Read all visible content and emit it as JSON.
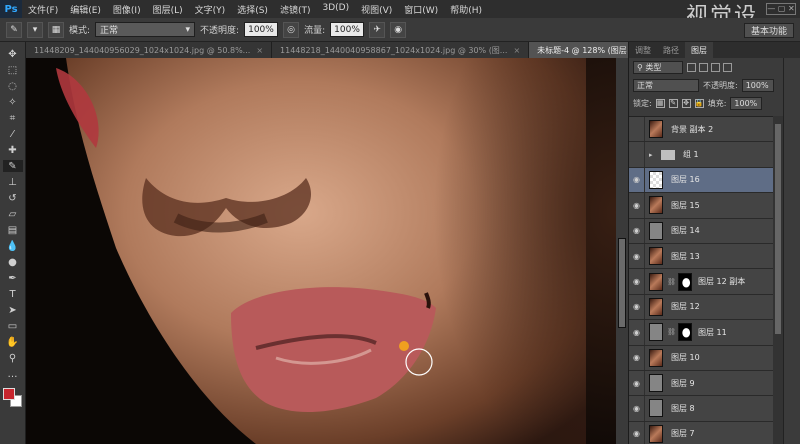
{
  "app": {
    "logo": "Ps"
  },
  "watermark": "视觉设",
  "menu": [
    "文件(F)",
    "编辑(E)",
    "图像(I)",
    "图层(L)",
    "文字(Y)",
    "选择(S)",
    "滤镜(T)",
    "3D(D)",
    "视图(V)",
    "窗口(W)",
    "帮助(H)"
  ],
  "options": {
    "mode_label": "模式:",
    "mode_value": "正常",
    "opacity_label": "不透明度:",
    "opacity_value": "100%",
    "flow_label": "流量:",
    "flow_value": "100%",
    "workspace": "基本功能"
  },
  "tabs": [
    {
      "label": "11448209_144040956029_1024x1024.jpg @ 50.8%...",
      "active": false
    },
    {
      "label": "11448218_1440040958867_1024x1024.jpg @ 30% (图...",
      "active": false
    },
    {
      "label": "未标题-4 @ 128% (图层 16, RGB/8) *",
      "active": true
    }
  ],
  "panel": {
    "tabs": [
      "调整",
      "路径",
      "图层"
    ],
    "active_tab": "图层",
    "kind": "类型",
    "blend_mode": "正常",
    "opacity_label": "不透明度:",
    "opacity_value": "100%",
    "lock_label": "锁定:",
    "fill_label": "填充:",
    "fill_value": "100%",
    "layers": [
      {
        "name": "背景 副本 2",
        "thumb": "face",
        "visible": false,
        "selected": false
      },
      {
        "name": "组 1",
        "thumb": "folder",
        "visible": false,
        "selected": false,
        "group": true
      },
      {
        "name": "图层 16",
        "thumb": "trans",
        "visible": true,
        "selected": true
      },
      {
        "name": "图层 15",
        "thumb": "face",
        "visible": true,
        "selected": false
      },
      {
        "name": "图层 14",
        "thumb": "gray",
        "visible": true,
        "selected": false
      },
      {
        "name": "图层 13",
        "thumb": "face",
        "visible": true,
        "selected": false
      },
      {
        "name": "图层 12 副本",
        "thumb": "face",
        "visible": true,
        "selected": false,
        "mask": true
      },
      {
        "name": "图层 12",
        "thumb": "face",
        "visible": true,
        "selected": false
      },
      {
        "name": "图层 11",
        "thumb": "gray",
        "visible": true,
        "selected": false,
        "mask": true
      },
      {
        "name": "图层 10",
        "thumb": "face",
        "visible": true,
        "selected": false
      },
      {
        "name": "图层 9",
        "thumb": "gray",
        "visible": true,
        "selected": false
      },
      {
        "name": "图层 8",
        "thumb": "gray",
        "visible": true,
        "selected": false
      },
      {
        "name": "图层 7",
        "thumb": "face",
        "visible": true,
        "selected": false
      }
    ]
  },
  "colors": {
    "foreground": "#c7262e",
    "background": "#ffffff",
    "selected_layer": "#5f6d86"
  }
}
